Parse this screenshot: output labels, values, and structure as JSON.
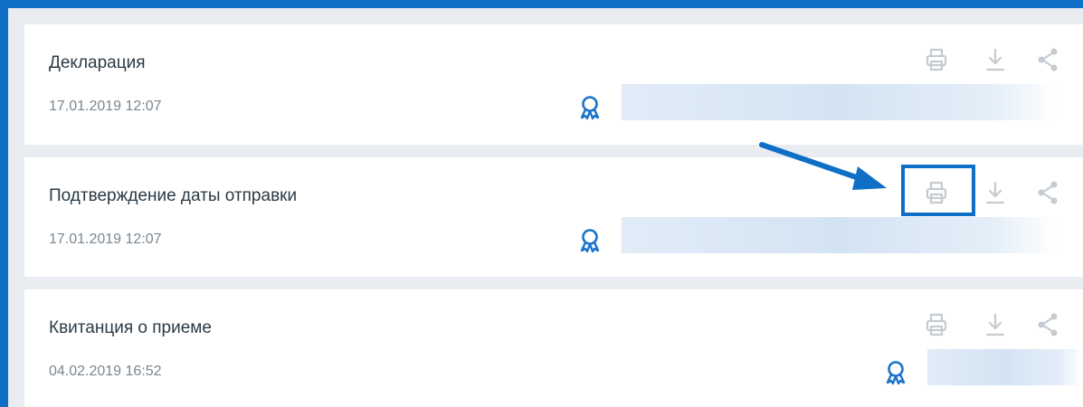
{
  "documents": [
    {
      "title": "Декларация",
      "date": "17.01.2019 12:07"
    },
    {
      "title": "Подтверждение даты отправки",
      "date": "17.01.2019 12:07"
    },
    {
      "title": "Квитанция о приеме",
      "date": "04.02.2019 16:52"
    }
  ],
  "actions": {
    "print": "printer-icon",
    "download": "download-icon",
    "share": "share-icon"
  },
  "colors": {
    "accent": "#0f6fc6",
    "icon_gray": "#c5cbd0",
    "title_text": "#2b3a45",
    "date_text": "#7a8791",
    "background": "#e9edf2"
  }
}
